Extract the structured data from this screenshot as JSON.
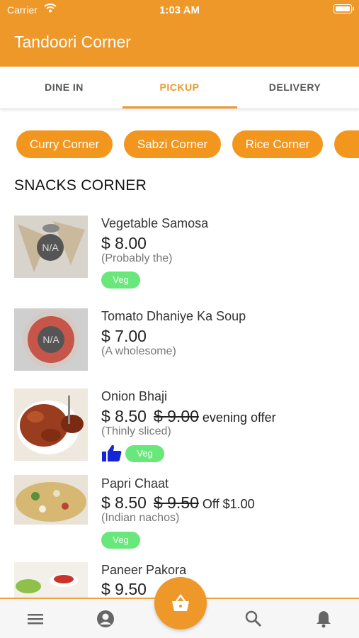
{
  "status_bar": {
    "carrier": "Carrier",
    "time": "1:03 AM"
  },
  "app_bar": {
    "title": "Tandoori Corner"
  },
  "tabs": [
    {
      "label": "DINE IN",
      "active": false
    },
    {
      "label": "PICKUP",
      "active": true
    },
    {
      "label": "DELIVERY",
      "active": false
    }
  ],
  "categories": [
    "Curry Corner",
    "Sabzi Corner",
    "Rice Corner"
  ],
  "section": {
    "title": "SNACKS CORNER"
  },
  "items": [
    {
      "name": "Vegetable Samosa",
      "price": "$ 8.00",
      "old_price": "",
      "offer": "",
      "description": "(Probably the)",
      "tag": "Veg",
      "placeholder": "N/A"
    },
    {
      "name": "Tomato Dhaniye Ka Soup",
      "price": "$ 7.00",
      "old_price": "",
      "offer": "",
      "description": "(A wholesome)",
      "tag": "",
      "placeholder": "N/A"
    },
    {
      "name": "Onion Bhaji",
      "price": "$ 8.50",
      "old_price": "$ 9.00",
      "offer": "evening offer",
      "description": "(Thinly sliced)",
      "tag": "Veg",
      "liked": true
    },
    {
      "name": "Papri Chaat",
      "price": "$ 8.50",
      "old_price": "$ 9.50",
      "offer": "Off $1.00",
      "description": "(Indian nachos)",
      "tag": "Veg"
    },
    {
      "name": "Paneer Pakora",
      "price": "$ 9.50",
      "old_price": "",
      "offer": "",
      "description": "",
      "tag": ""
    }
  ],
  "bottom_nav": {
    "icons": [
      "menu-icon",
      "account-icon",
      "cart-icon",
      "search-icon",
      "bell-icon"
    ]
  },
  "colors": {
    "primary": "#ed9829",
    "veg": "#68e87a",
    "like": "#1524d6"
  }
}
